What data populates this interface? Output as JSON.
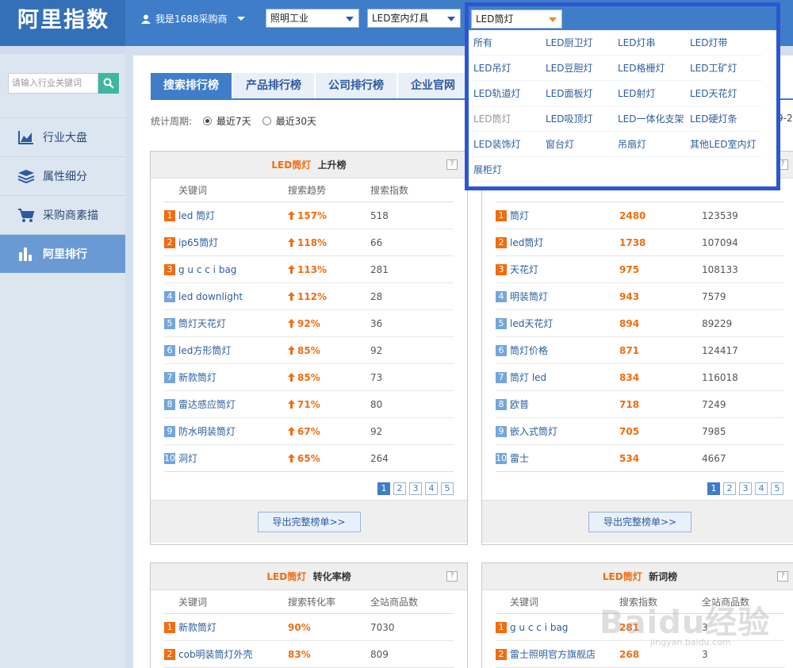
{
  "header": {
    "logo": "阿里指数",
    "user_label": "我是1688采购商",
    "industry_select": "照明工业",
    "category_select": "LED室内灯具"
  },
  "sidebar": {
    "search_placeholder": "请输入行业关键词",
    "items": [
      {
        "label": "行业大盘",
        "icon": "chart-area-icon"
      },
      {
        "label": "属性细分",
        "icon": "layers-icon"
      },
      {
        "label": "采购商素描",
        "icon": "cart-icon"
      },
      {
        "label": "阿里排行",
        "icon": "bar-chart-icon"
      }
    ],
    "active_index": 3
  },
  "tabs": [
    "搜索排行榜",
    "产品排行榜",
    "公司排行榜",
    "企业官网"
  ],
  "period": {
    "label": "统计周期:",
    "options": [
      "最近7天",
      "最近30天"
    ],
    "selected": 0,
    "date_fragment": "9-2"
  },
  "dropdown": {
    "selected": "LED筒灯",
    "items": [
      "所有",
      "LED厨卫灯",
      "LED灯串",
      "LED灯带",
      "LED吊灯",
      "LED豆胆灯",
      "LED格栅灯",
      "LED工矿灯",
      "LED轨道灯",
      "LED面板灯",
      "LED射灯",
      "LED天花灯",
      "LED筒灯",
      "LED吸顶灯",
      "LED一体化支架",
      "LED硬灯条",
      "LED装饰灯",
      "窗台灯",
      "吊扇灯",
      "其他LED室内灯",
      "展柜灯"
    ]
  },
  "panels": {
    "rise": {
      "highlight": "LED筒灯",
      "title": "上升榜",
      "columns": [
        "关键词",
        "搜索趋势",
        "搜索指数"
      ],
      "rows": [
        {
          "rank": "1",
          "kw": "led 筒灯",
          "trend": "157%",
          "index": "518"
        },
        {
          "rank": "2",
          "kw": "ip65筒灯",
          "trend": "118%",
          "index": "66"
        },
        {
          "rank": "3",
          "kw": "g u c c i bag",
          "trend": "113%",
          "index": "281"
        },
        {
          "rank": "4",
          "kw": "led downlight",
          "trend": "112%",
          "index": "28"
        },
        {
          "rank": "5",
          "kw": "筒灯天花灯",
          "trend": "92%",
          "index": "36"
        },
        {
          "rank": "6",
          "kw": "led方形筒灯",
          "trend": "85%",
          "index": "92"
        },
        {
          "rank": "7",
          "kw": "新款筒灯",
          "trend": "85%",
          "index": "73"
        },
        {
          "rank": "8",
          "kw": "雷达感应筒灯",
          "trend": "71%",
          "index": "80"
        },
        {
          "rank": "9",
          "kw": "防水明装筒灯",
          "trend": "67%",
          "index": "92"
        },
        {
          "rank": "10",
          "kw": "洞灯",
          "trend": "65%",
          "index": "264"
        }
      ],
      "pages": [
        "1",
        "2",
        "3",
        "4",
        "5"
      ],
      "export": "导出完整榜单>>"
    },
    "hot": {
      "rows": [
        {
          "rank": "1",
          "kw": "筒灯",
          "index": "2480",
          "count": "123539"
        },
        {
          "rank": "2",
          "kw": "led筒灯",
          "index": "1738",
          "count": "107094"
        },
        {
          "rank": "3",
          "kw": "天花灯",
          "index": "975",
          "count": "108133"
        },
        {
          "rank": "4",
          "kw": "明装筒灯",
          "index": "943",
          "count": "7579"
        },
        {
          "rank": "5",
          "kw": "led天花灯",
          "index": "894",
          "count": "89229"
        },
        {
          "rank": "6",
          "kw": "筒灯价格",
          "index": "871",
          "count": "124417"
        },
        {
          "rank": "7",
          "kw": "筒灯 led",
          "index": "834",
          "count": "116018"
        },
        {
          "rank": "8",
          "kw": "欧普",
          "index": "718",
          "count": "7249"
        },
        {
          "rank": "9",
          "kw": "嵌入式筒灯",
          "index": "705",
          "count": "7985"
        },
        {
          "rank": "10",
          "kw": "雷士",
          "index": "534",
          "count": "4667"
        }
      ],
      "pages": [
        "1",
        "2",
        "3",
        "4",
        "5"
      ],
      "export": "导出完整榜单>>"
    },
    "conversion": {
      "highlight": "LED筒灯",
      "title": "转化率榜",
      "columns": [
        "关键词",
        "搜索转化率",
        "全站商品数"
      ],
      "rows": [
        {
          "rank": "1",
          "kw": "新款筒灯",
          "rate": "90%",
          "count": "7030"
        },
        {
          "rank": "2",
          "kw": "cob明装筒灯外壳",
          "rate": "83%",
          "count": "809"
        }
      ]
    },
    "newwords": {
      "highlight": "LED筒灯",
      "title": "新词榜",
      "columns": [
        "关键词",
        "搜索指数",
        "全站商品数"
      ],
      "rows": [
        {
          "rank": "1",
          "kw": "g u c c i bag",
          "index": "281",
          "count": "3"
        },
        {
          "rank": "2",
          "kw": "雷士照明官方旗舰店",
          "index": "268",
          "count": "3"
        }
      ]
    }
  },
  "watermark": {
    "text": "Baidu经验",
    "sub": "jingyan.baidu.com"
  },
  "colors": {
    "header": "#3f7dc9",
    "accent": "#f26c0f",
    "popup_border": "#2d57d0"
  }
}
